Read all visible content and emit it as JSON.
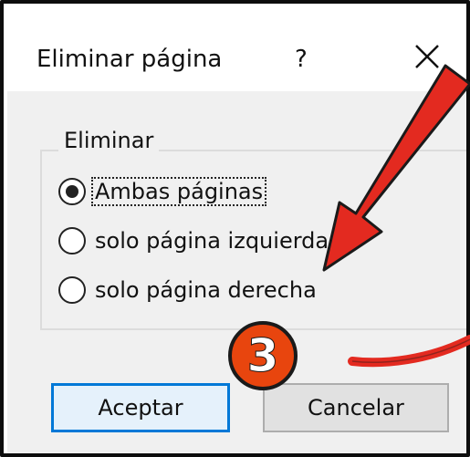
{
  "dialog": {
    "title": "Eliminar página",
    "help_label": "?",
    "close_icon": "close-icon"
  },
  "group": {
    "label": "Eliminar",
    "options": [
      {
        "label": "Ambas páginas",
        "checked": true
      },
      {
        "label": "solo página izquierda",
        "checked": false
      },
      {
        "label": "solo página derecha",
        "checked": false
      }
    ]
  },
  "buttons": {
    "ok_label": "Aceptar",
    "cancel_label": "Cancelar"
  },
  "annotation": {
    "step_number": "3",
    "arrow_color": "#e32a20",
    "badge_color": "#e8450e"
  }
}
